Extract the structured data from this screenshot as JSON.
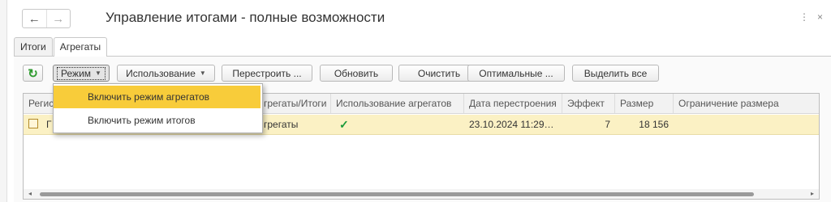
{
  "window": {
    "title": "Управление итогами - полные возможности",
    "back_icon": "←",
    "forward_icon": "→",
    "menu_icon": "⋮",
    "close_icon": "×"
  },
  "tabs": [
    {
      "label": "Итоги",
      "active": false
    },
    {
      "label": "Агрегаты",
      "active": true
    }
  ],
  "toolbar": {
    "refresh_icon": "↻",
    "mode_label": "Режим",
    "usage_label": "Использование",
    "rebuild_label": "Перестроить ...",
    "update_label": "Обновить",
    "clear_label": "Очистить",
    "optimal_label": "Оптимальные ...",
    "select_all_label": "Выделить все"
  },
  "grid": {
    "columns": [
      "Регис",
      "грегаты/Итоги",
      "Использование агрегатов",
      "Дата перестроения",
      "Эффект",
      "Размер",
      "Ограничение размера"
    ],
    "rows": [
      {
        "name": "Г",
        "mode": "грегаты",
        "usage": "✓",
        "date": "23.10.2024 11:29…",
        "effect": "7",
        "size": "18 156",
        "limit": ""
      }
    ]
  },
  "dropdown": {
    "items": [
      {
        "label": "Включить режим агрегатов",
        "highlighted": true
      },
      {
        "label": "Включить режим итогов",
        "highlighted": false
      }
    ]
  },
  "colors": {
    "accent_highlight": "#f8cc3a",
    "selected_row": "#fbf1c4",
    "check_green": "#1a9a3a"
  }
}
